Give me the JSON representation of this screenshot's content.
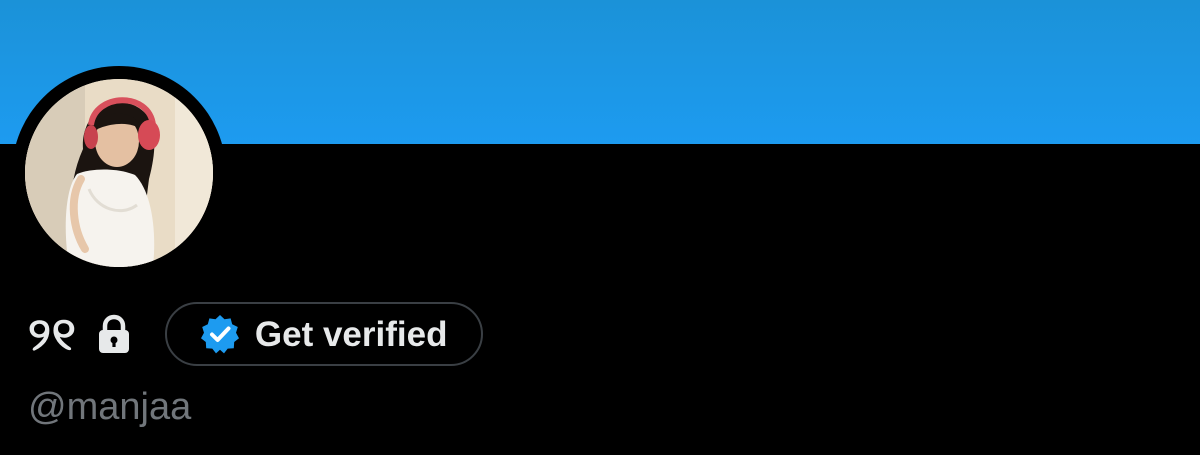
{
  "profile": {
    "display_name": "୨୧",
    "handle": "@manjaa",
    "verify_button_label": "Get verified"
  },
  "icons": {
    "lock": "lock-icon",
    "verified_badge": "verified-badge-icon"
  },
  "colors": {
    "banner": "#1d9bf0",
    "background": "#000000",
    "primary_text": "#e7e9ea",
    "secondary_text": "#71767b",
    "badge_blue": "#1d9bf0",
    "button_border": "#3a3f44"
  }
}
